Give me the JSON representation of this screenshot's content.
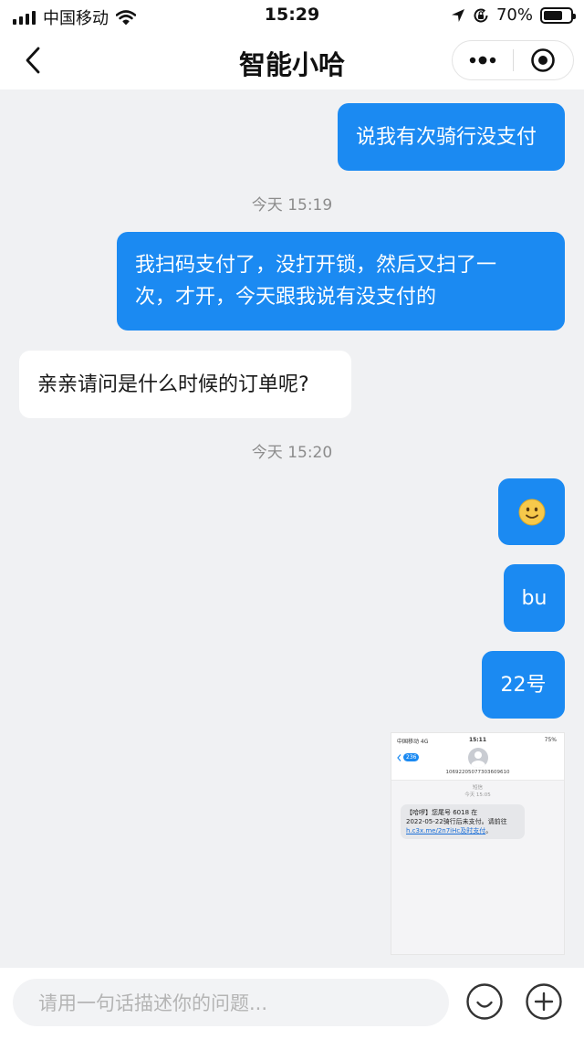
{
  "status_bar": {
    "carrier": "中国移动",
    "time": "15:29",
    "battery": "70%",
    "battery_level": 0.7
  },
  "nav": {
    "title": "智能小哈"
  },
  "messages": [
    {
      "side": "out",
      "text": "说我有次骑行没支付"
    },
    {
      "timestamp": "今天 15:19"
    },
    {
      "side": "out",
      "lines": [
        "我扫码支付了，没打开锁，然后又扫了一",
        "次，才开，今天跟我说有没支付的"
      ]
    },
    {
      "side": "in",
      "text": "亲亲请问是什么时候的订单呢?"
    },
    {
      "timestamp": "今天 15:20"
    },
    {
      "side": "out",
      "emoji": "🙂"
    },
    {
      "side": "out",
      "text": "bu"
    },
    {
      "side": "out",
      "text": "22号"
    }
  ],
  "attachment": {
    "status_carrier": "中国移动 4G",
    "status_time": "15:11",
    "status_battery": "75%",
    "unread_badge": "236",
    "sender_number": "10692205077303609610",
    "meta_label": "短信",
    "meta_time": "今天 15:05",
    "sms_line1": "【哈啰】您尾号 6018 在",
    "sms_line2": "2022-05-22骑行后未支付。请前往",
    "sms_link": "h.c3x.me/2n7iHc",
    "sms_link_suffix": "及时支付",
    "sms_end": "。"
  },
  "input": {
    "placeholder": "请用一句话描述你的问题..."
  },
  "icons": {
    "back": "chevron-left-icon",
    "more": "more-dots-icon",
    "close": "target-circle-icon",
    "emoji": "smiley-icon",
    "add": "plus-circle-icon"
  },
  "colors": {
    "outgoing_bubble": "#1b8af2",
    "incoming_bubble": "#ffffff",
    "chat_background": "#f0f1f3",
    "link": "#1b6fd8"
  }
}
